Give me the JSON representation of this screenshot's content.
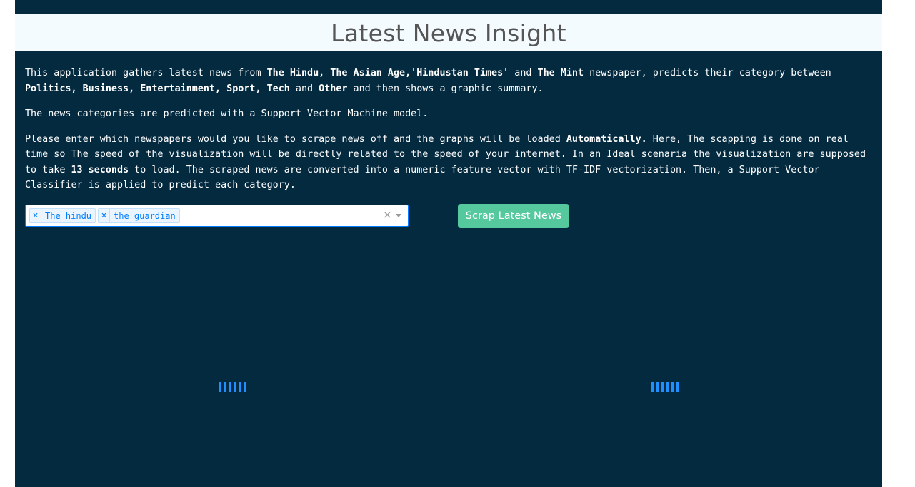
{
  "header": {
    "title": "Latest News Insight"
  },
  "intro": {
    "p1_a": "This application gathers latest news from ",
    "p1_b": "The Hindu, The Asian Age,'Hindustan Times'",
    "p1_c": " and ",
    "p1_d": "The Mint",
    "p1_e": " newspaper, predicts their category between ",
    "p1_f": "Politics, Business, Entertainment, Sport, Tech",
    "p1_g": " and ",
    "p1_h": "Other",
    "p1_i": " and then shows a graphic summary.",
    "p2": "The news categories are predicted with a Support Vector Machine model.",
    "p3_a": "Please enter which newspapers would you like to scrape news off and the graphs will be loaded ",
    "p3_b": "Automatically.",
    "p3_c": " Here, The scapping is done on real time so The speed of the visualization will be directly related to the speed of your internet. In an Ideal scenaria the visualization are supposed to take ",
    "p3_d": "13 seconds",
    "p3_e": " to load. The scraped news are converted into a numeric feature vector with TF-IDF vectorization. Then, a Support Vector Classifier is applied to predict each category."
  },
  "newspaper_select": {
    "selected": [
      {
        "label": "The hindu"
      },
      {
        "label": "the guardian"
      }
    ],
    "remove_glyph": "×",
    "clear_glyph": "×"
  },
  "actions": {
    "scrap_label": "Scrap Latest News"
  },
  "colors": {
    "background": "#042a40",
    "header_bg": "#f4fbff",
    "button": "#56c89e",
    "loader": "#1e90ff",
    "chip_text": "#007eff"
  },
  "icons": {
    "chip_remove": "close-icon",
    "clear": "clear-icon",
    "dropdown": "chevron-down-icon",
    "loading": "loading-spinner-icon"
  }
}
